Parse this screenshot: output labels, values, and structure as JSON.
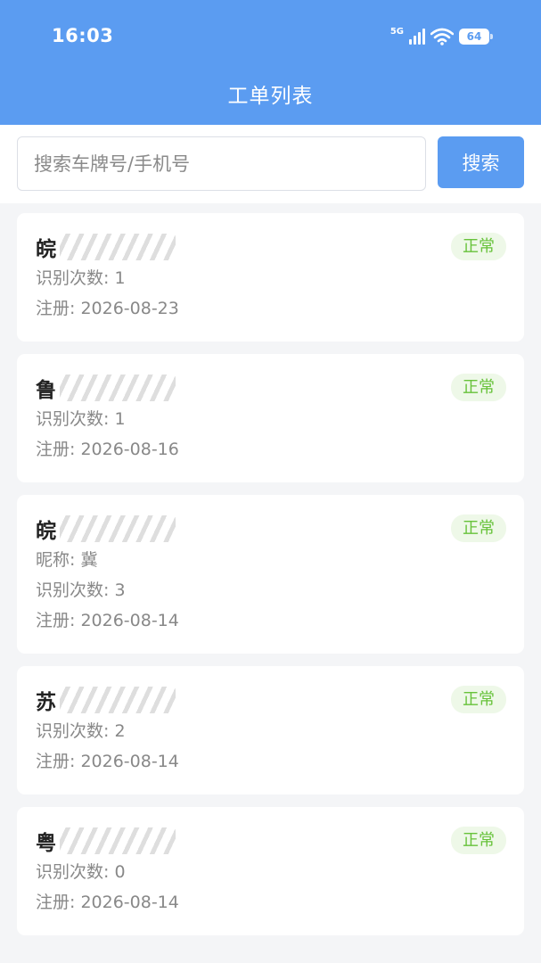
{
  "status_bar": {
    "time": "16:03",
    "network": "5G",
    "battery": "64"
  },
  "header": {
    "title": "工单列表"
  },
  "search": {
    "placeholder": "搜索车牌号/手机号",
    "value": "",
    "button_label": "搜索"
  },
  "labels": {
    "count": "识别次数: ",
    "register": "注册: ",
    "nickname": "昵称: "
  },
  "colors": {
    "primary": "#5b9cf1",
    "status_green": "#67c23a",
    "status_bg": "#eef8e8"
  },
  "cards": [
    {
      "plate_prefix": "皖",
      "status": "正常",
      "nickname_line": null,
      "count_line": "识别次数: 1",
      "register_line": "注册: 2026-08-23"
    },
    {
      "plate_prefix": "鲁",
      "status": "正常",
      "nickname_line": null,
      "count_line": "识别次数: 1",
      "register_line": "注册: 2026-08-16"
    },
    {
      "plate_prefix": "皖",
      "status": "正常",
      "nickname_line": "昵称: 冀",
      "count_line": "识别次数: 3",
      "register_line": "注册: 2026-08-14"
    },
    {
      "plate_prefix": "苏",
      "status": "正常",
      "nickname_line": null,
      "count_line": "识别次数: 2",
      "register_line": "注册: 2026-08-14"
    },
    {
      "plate_prefix": "粤",
      "status": "正常",
      "nickname_line": null,
      "count_line": "识别次数: 0",
      "register_line": "注册: 2026-08-14"
    }
  ]
}
